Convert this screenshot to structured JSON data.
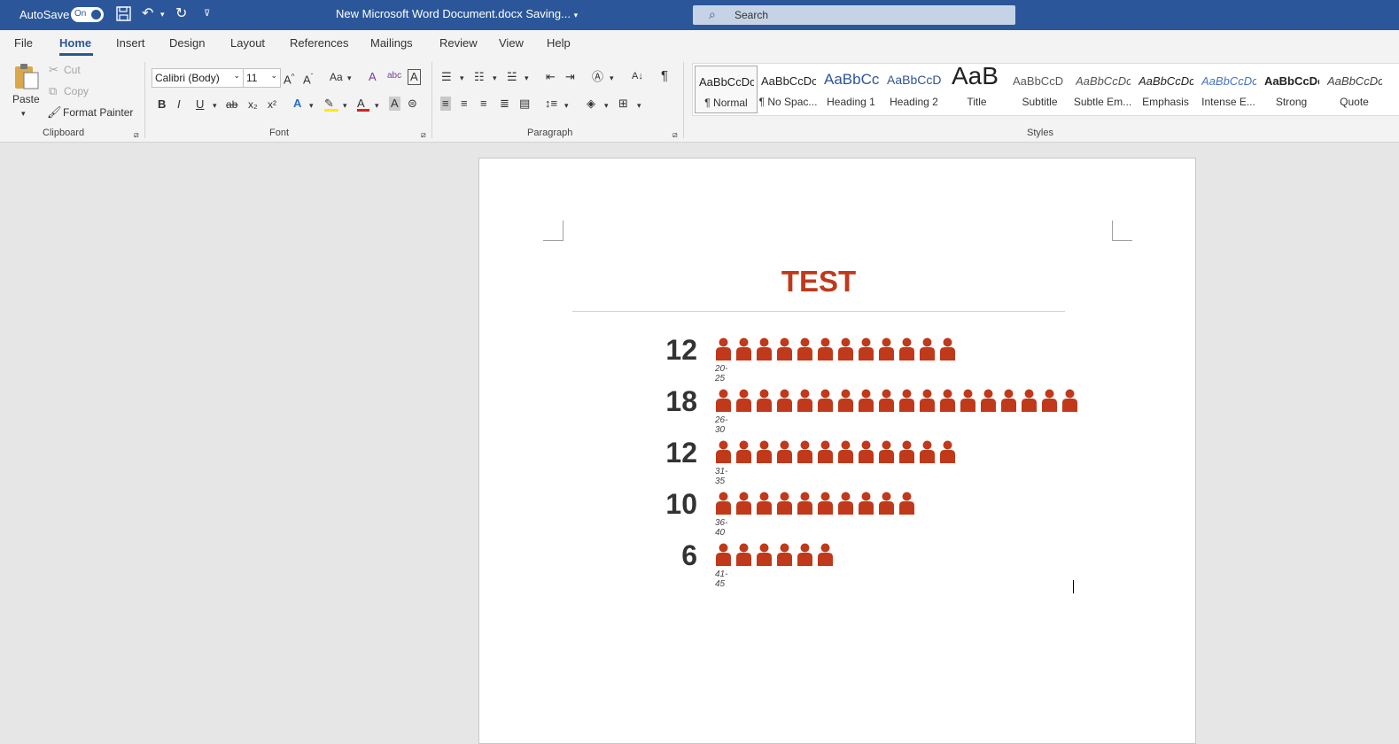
{
  "titlebar": {
    "autosave_label": "AutoSave",
    "autosave_state": "On",
    "doc_title": "New Microsoft Word Document.docx",
    "status": "Saving...",
    "search_placeholder": "Search"
  },
  "tabs": [
    "File",
    "Home",
    "Insert",
    "Design",
    "Layout",
    "References",
    "Mailings",
    "Review",
    "View",
    "Help"
  ],
  "active_tab": "Home",
  "ribbon": {
    "clipboard": {
      "label": "Clipboard",
      "paste": "Paste",
      "cut": "Cut",
      "copy": "Copy",
      "format_painter": "Format Painter"
    },
    "font": {
      "label": "Font",
      "font_name": "Calibri (Body)",
      "font_size": "11",
      "case_btn": "Aa",
      "bold": "B",
      "italic": "I",
      "underline": "U",
      "strike": "ab",
      "subscript": "x₂",
      "superscript": "x²"
    },
    "paragraph": {
      "label": "Paragraph"
    },
    "styles": {
      "label": "Styles",
      "items": [
        {
          "preview": "AaBbCcDc",
          "name": "¶ Normal"
        },
        {
          "preview": "AaBbCcDc",
          "name": "¶ No Spac..."
        },
        {
          "preview": "AaBbCc",
          "name": "Heading 1"
        },
        {
          "preview": "AaBbCcD",
          "name": "Heading 2"
        },
        {
          "preview": "AaB",
          "name": "Title"
        },
        {
          "preview": "AaBbCcD",
          "name": "Subtitle"
        },
        {
          "preview": "AaBbCcDc",
          "name": "Subtle Em..."
        },
        {
          "preview": "AaBbCcDc",
          "name": "Emphasis"
        },
        {
          "preview": "AaBbCcDc",
          "name": "Intense E..."
        },
        {
          "preview": "AaBbCcDc",
          "name": "Strong"
        },
        {
          "preview": "AaBbCcDc",
          "name": "Quote"
        }
      ]
    }
  },
  "document": {
    "title": "TEST",
    "accent": "#c0391a",
    "rows": [
      {
        "count": "12",
        "label": "20-25",
        "people": 12
      },
      {
        "count": "18",
        "label": "26-30",
        "people": 18
      },
      {
        "count": "12",
        "label": "31-35",
        "people": 12
      },
      {
        "count": "10",
        "label": "36-40",
        "people": 10
      },
      {
        "count": "6",
        "label": "41-45",
        "people": 6
      }
    ]
  }
}
